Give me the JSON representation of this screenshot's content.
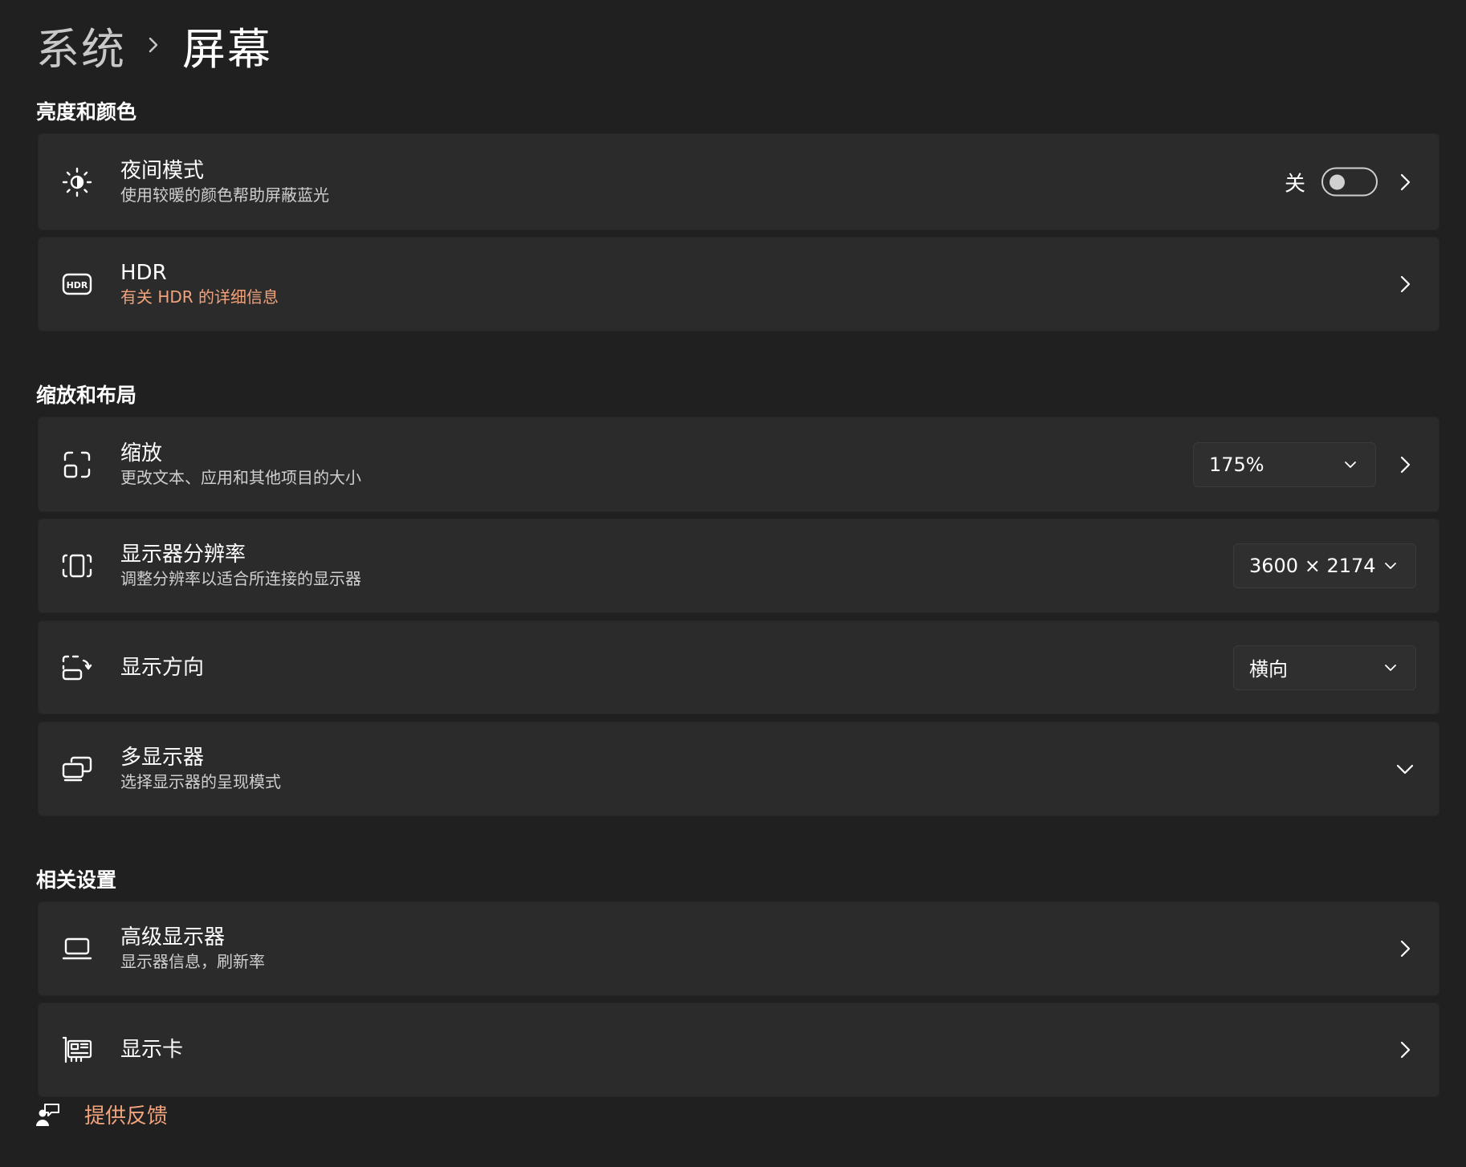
{
  "breadcrumb": {
    "parent": "系统",
    "current": "屏幕"
  },
  "sections": {
    "brightness_color": "亮度和颜色",
    "scale_layout": "缩放和布局",
    "related": "相关设置"
  },
  "night_light": {
    "title": "夜间模式",
    "subtitle": "使用较暖的颜色帮助屏蔽蓝光",
    "toggle_label": "关",
    "toggle_on": false,
    "icon": "brightness-icon"
  },
  "hdr": {
    "title": "HDR",
    "subtitle": "有关 HDR 的详细信息",
    "icon": "hdr-icon"
  },
  "scale": {
    "title": "缩放",
    "subtitle": "更改文本、应用和其他项目的大小",
    "value": "175%",
    "icon": "scale-icon"
  },
  "resolution": {
    "title": "显示器分辨率",
    "subtitle": "调整分辨率以适合所连接的显示器",
    "value": "3600 × 2174",
    "icon": "resolution-icon"
  },
  "orientation": {
    "title": "显示方向",
    "value": "横向",
    "icon": "orientation-icon"
  },
  "multi_display": {
    "title": "多显示器",
    "subtitle": "选择显示器的呈现模式",
    "icon": "multiple-displays-icon"
  },
  "advanced_display": {
    "title": "高级显示器",
    "subtitle": "显示器信息，刷新率",
    "icon": "laptop-icon"
  },
  "graphics": {
    "title": "显示卡",
    "icon": "graphics-card-icon"
  },
  "feedback": {
    "label": "提供反馈",
    "icon": "feedback-icon"
  },
  "colors": {
    "background": "#202020",
    "card": "#2b2b2b",
    "accent_link": "#f0a37c"
  }
}
